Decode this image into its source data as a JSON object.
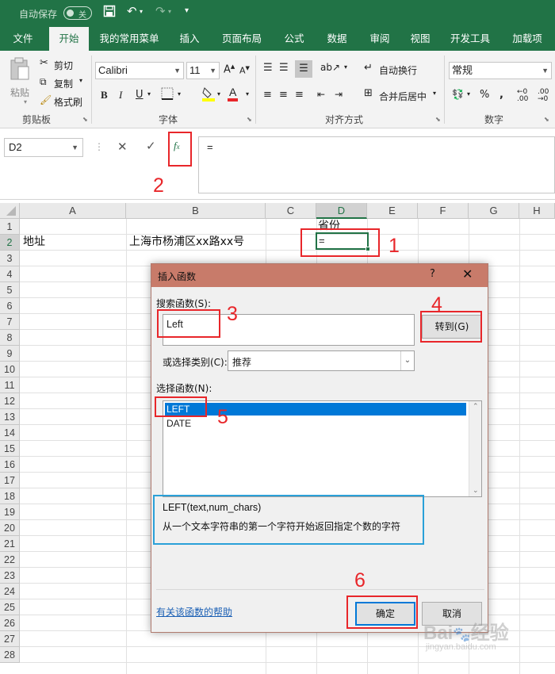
{
  "qat": {
    "autosave_label": "自动保存",
    "toggle_label": "关"
  },
  "tabs": [
    "文件",
    "开始",
    "我的常用菜单",
    "插入",
    "页面布局",
    "公式",
    "数据",
    "审阅",
    "视图",
    "开发工具",
    "加载项"
  ],
  "ribbon": {
    "clipboard": {
      "paste": "粘贴",
      "cut": "剪切",
      "copy": "复制",
      "format_painter": "格式刷",
      "group": "剪贴板"
    },
    "font": {
      "name": "Calibri",
      "size": "11",
      "group": "字体"
    },
    "alignment": {
      "wrap": "自动换行",
      "merge": "合并后居中",
      "group": "对齐方式"
    },
    "number": {
      "format": "常规",
      "group": "数字"
    }
  },
  "formula_bar": {
    "name_box": "D2",
    "content": "="
  },
  "grid": {
    "columns": [
      "A",
      "B",
      "C",
      "D",
      "E",
      "F",
      "G",
      "H"
    ],
    "rows": [
      "1",
      "2",
      "3",
      "4",
      "5",
      "6",
      "7",
      "8",
      "9",
      "10",
      "11",
      "12",
      "13",
      "14",
      "15",
      "16",
      "17",
      "18",
      "19",
      "20",
      "21",
      "22",
      "23",
      "24",
      "25",
      "26",
      "27",
      "28"
    ],
    "cells": {
      "D1": "省份",
      "A2": "地址",
      "B2": "上海市杨浦区xx路xx号",
      "D2": "="
    }
  },
  "dialog": {
    "title": "插入函数",
    "help": "?",
    "search_label": "搜索函数(S):",
    "search_value": "Left",
    "go_button": "转到(G)",
    "category_label": "或选择类别(C):",
    "category_value": "推荐",
    "select_label": "选择函数(N):",
    "functions": [
      "LEFT",
      "DATE"
    ],
    "syntax": "LEFT(text,num_chars)",
    "description": "从一个文本字符串的第一个字符开始返回指定个数的字符",
    "help_link": "有关该函数的帮助",
    "ok_button": "确定",
    "cancel_button": "取消"
  },
  "annotations": [
    "1",
    "2",
    "3",
    "4",
    "5",
    "6"
  ],
  "colors": {
    "excel_green": "#217346",
    "dialog_title": "#c87b6a",
    "annotation_red": "#e8262a",
    "annotation_blue": "#2aa0d8",
    "selection": "#0078d7"
  }
}
